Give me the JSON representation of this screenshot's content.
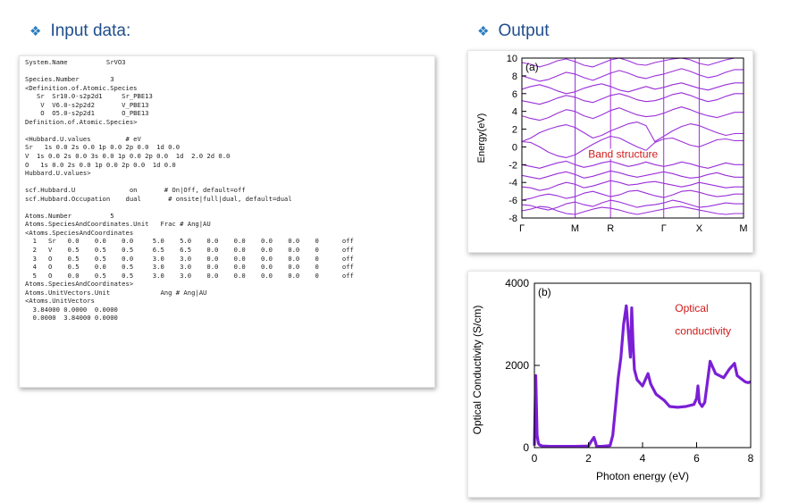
{
  "input_heading": {
    "bullet": "❖",
    "text": "Input data:"
  },
  "output_heading": {
    "bullet": "❖",
    "text": "Output"
  },
  "input_lines": [
    "System.Name          SrVO3",
    "",
    "Species.Number        3",
    "<Definition.of.Atomic.Species",
    "   Sr  Sr10.0-s2p2d1     Sr_PBE13",
    "    V  V6.0-s2p2d2       V_PBE13",
    "    O  O5.0-s2p2d1       O_PBE13",
    "Definition.of.Atomic.Species>",
    "",
    "<Hubbard.U.values         # eV",
    "Sr   1s 0.0 2s 0.0 1p 0.0 2p 0.0  1d 0.0",
    "V  1s 0.0 2s 0.0 3s 0.0 1p 0.0 2p 0.0  1d  2.0 2d 0.0",
    "O   1s 0.0 2s 0.0 1p 0.0 2p 0.0  1d 0.0",
    "Hubbard.U.values>",
    "",
    "scf.Hubbard.U              on       # On|Off, default=off",
    "scf.Hubbard.Occupation    dual       # onsite|full|dual, default=dual",
    "",
    "Atoms.Number          5",
    "Atoms.SpeciesAndCoordinates.Unit   Frac # Ang|AU",
    "<Atoms.SpeciesAndCoordinates",
    "  1   Sr   0.0    0.0    0.0     5.0    5.0    0.0    0.0    0.0    0.0    0      off",
    "  2   V    0.5    0.5    0.5     6.5    6.5    0.0    0.0    0.0    0.0    0      off",
    "  3   O    0.5    0.5    0.0     3.0    3.0    0.0    0.0    0.0    0.0    0      off",
    "  4   O    0.5    0.0    0.5     3.0    3.0    0.0    0.0    0.0    0.0    0      off",
    "  5   O    0.0    0.5    0.5     3.0    3.0    0.0    0.0    0.0    0.0    0      off",
    "Atoms.SpeciesAndCoordinates>",
    "Atoms.UnitVectors.Unit             Ang # Ang|AU",
    "<Atoms.UnitVectors",
    "  3.84000 0.0000  0.0000",
    "  0.0000  3.84000 0.0000"
  ],
  "band_plot": {
    "panel_label": "(a)",
    "annotation": "Band structure",
    "annotation_color": "#d11a1a",
    "ylabel": "Energy(eV)",
    "ylim": [
      -8,
      10
    ],
    "yticks": [
      "10",
      "8",
      "6",
      "4",
      "2",
      "0",
      "-2",
      "-4",
      "-6",
      "-8"
    ],
    "kpoints": [
      "Γ",
      "M",
      "R",
      "Γ",
      "X",
      "M"
    ],
    "line_color": "#9b30d9"
  },
  "cond_plot": {
    "panel_label": "(b)",
    "annotation_line1": "Optical",
    "annotation_line2": "conductivity",
    "annotation_color": "#d11a1a",
    "ylabel": "Optical Conductivity (S/cm)",
    "xlabel": "Photon energy (eV)",
    "ylim": [
      0,
      4000
    ],
    "xlim": [
      0,
      8
    ],
    "yticks": [
      "4000",
      "2000",
      "0"
    ],
    "xticks": [
      "0",
      "2",
      "4",
      "6",
      "8"
    ],
    "line_color": "#7b1fd6"
  },
  "chart_data": [
    {
      "type": "line",
      "title": "",
      "xlabel": "",
      "ylabel": "Energy(eV)",
      "ylim": [
        -8,
        10
      ],
      "x_tick_labels": [
        "Γ",
        "M",
        "R",
        "Γ",
        "X",
        "M"
      ],
      "x": [
        0.0,
        0.2,
        0.4,
        0.6,
        0.8,
        1.0,
        1.2,
        1.4,
        1.6,
        1.8,
        2.0,
        2.2,
        2.4,
        2.6,
        2.8,
        3.0,
        3.2,
        3.4,
        3.6,
        3.8,
        4.0,
        4.2,
        4.4,
        4.6,
        4.8,
        5.0
      ],
      "series": [
        {
          "values": [
            -7.2,
            -7.0,
            -6.7,
            -6.8,
            -7.2,
            -7.5,
            -7.6,
            -7.3,
            -7.0,
            -6.8,
            -6.9,
            -7.1,
            -7.4,
            -7.6,
            -7.4,
            -7.2,
            -7.0,
            -6.8,
            -6.7,
            -6.9,
            -7.1,
            -7.3,
            -7.5,
            -7.6,
            -7.5,
            -7.5
          ]
        },
        {
          "values": [
            -6.5,
            -6.6,
            -6.9,
            -7.1,
            -6.8,
            -6.4,
            -6.2,
            -6.5,
            -6.7,
            -6.3,
            -6.0,
            -6.2,
            -6.5,
            -6.8,
            -6.6,
            -6.5,
            -6.3,
            -6.0,
            -6.2,
            -6.5,
            -6.8,
            -6.7,
            -6.5,
            -6.3,
            -6.4,
            -6.4
          ]
        },
        {
          "values": [
            -6.0,
            -5.8,
            -5.5,
            -5.3,
            -5.5,
            -5.8,
            -5.6,
            -5.2,
            -5.0,
            -5.3,
            -5.6,
            -5.4,
            -5.0,
            -4.9,
            -5.2,
            -5.5,
            -5.7,
            -5.4,
            -5.0,
            -4.9,
            -5.1,
            -5.4,
            -5.6,
            -5.5,
            -5.3,
            -5.3
          ]
        },
        {
          "values": [
            -4.5,
            -4.6,
            -4.9,
            -4.7,
            -4.3,
            -4.0,
            -4.2,
            -4.6,
            -4.4,
            -4.1,
            -3.8,
            -4.0,
            -4.3,
            -4.2,
            -4.0,
            -3.9,
            -4.1,
            -4.3,
            -4.5,
            -4.3,
            -4.0,
            -4.2,
            -4.4,
            -4.6,
            -4.5,
            -4.5
          ]
        },
        {
          "values": [
            -3.2,
            -3.4,
            -3.6,
            -3.3,
            -3.0,
            -2.8,
            -3.1,
            -3.5,
            -3.3,
            -3.0,
            -2.7,
            -2.9,
            -3.2,
            -3.4,
            -3.2,
            -3.0,
            -2.8,
            -3.0,
            -3.3,
            -3.5,
            -3.4,
            -3.1,
            -2.9,
            -3.2,
            -3.4,
            -3.4
          ]
        },
        {
          "values": [
            -2.0,
            -2.2,
            -2.4,
            -2.1,
            -1.8,
            -1.6,
            -2.0,
            -2.3,
            -2.1,
            -1.8,
            -1.6,
            -1.9,
            -2.2,
            -2.0,
            -1.7,
            -2.0,
            -2.2,
            -2.0,
            -1.7,
            -1.9,
            -2.2,
            -2.4,
            -2.1,
            -1.8,
            -2.0,
            -2.0
          ]
        },
        {
          "values": [
            0.6,
            0.5,
            0.0,
            -0.6,
            -1.0,
            -1.2,
            -0.9,
            -0.3,
            0.3,
            0.8,
            1.2,
            1.0,
            0.5,
            0.0,
            -0.4,
            0.5,
            0.9,
            1.0,
            0.6,
            0.2,
            0.0,
            0.4,
            0.8,
            0.9,
            0.7,
            0.7
          ]
        },
        {
          "values": [
            0.6,
            1.0,
            1.6,
            2.0,
            2.3,
            2.5,
            2.2,
            1.6,
            1.0,
            1.3,
            1.8,
            2.2,
            2.6,
            2.8,
            2.4,
            0.6,
            1.2,
            1.8,
            2.3,
            2.6,
            2.4,
            2.0,
            1.6,
            1.3,
            1.5,
            1.5
          ]
        },
        {
          "values": [
            3.5,
            3.2,
            3.0,
            3.3,
            3.8,
            4.2,
            4.0,
            3.5,
            3.2,
            3.6,
            4.1,
            4.4,
            4.0,
            3.6,
            3.4,
            3.5,
            3.8,
            4.2,
            4.5,
            4.2,
            3.8,
            3.5,
            3.3,
            3.6,
            3.9,
            3.9
          ]
        },
        {
          "values": [
            5.2,
            5.0,
            4.8,
            5.1,
            5.5,
            5.8,
            5.6,
            5.2,
            5.0,
            5.4,
            5.8,
            6.0,
            5.7,
            5.3,
            5.1,
            5.2,
            5.5,
            5.9,
            6.1,
            5.8,
            5.4,
            5.1,
            5.3,
            5.7,
            6.0,
            6.0
          ]
        },
        {
          "values": [
            6.5,
            6.8,
            7.0,
            6.7,
            6.3,
            6.0,
            6.2,
            6.6,
            6.9,
            7.1,
            6.8,
            6.4,
            6.2,
            6.5,
            6.8,
            6.5,
            6.7,
            7.0,
            7.2,
            6.9,
            6.6,
            6.4,
            6.7,
            7.0,
            7.2,
            7.2
          ]
        },
        {
          "values": [
            8.0,
            7.7,
            7.4,
            7.6,
            8.0,
            8.4,
            8.2,
            7.8,
            7.5,
            7.9,
            8.3,
            8.6,
            8.3,
            7.9,
            7.7,
            8.0,
            8.2,
            8.5,
            8.8,
            8.5,
            8.1,
            7.8,
            8.0,
            8.4,
            8.7,
            8.7
          ]
        },
        {
          "values": [
            9.5,
            9.3,
            9.0,
            9.3,
            9.7,
            9.9,
            9.6,
            9.2,
            9.0,
            9.4,
            9.8,
            10.0,
            9.7,
            9.3,
            9.2,
            9.5,
            9.7,
            9.9,
            10.0,
            9.8,
            9.4,
            9.2,
            9.5,
            9.8,
            10.0,
            10.0
          ]
        }
      ]
    },
    {
      "type": "line",
      "title": "",
      "xlabel": "Photon energy (eV)",
      "ylabel": "Optical Conductivity (S/cm)",
      "xlim": [
        0,
        8
      ],
      "ylim": [
        0,
        4000
      ],
      "series": [
        {
          "x": [
            0.0,
            0.05,
            0.1,
            0.15,
            0.2,
            0.3,
            0.6,
            1.0,
            1.5,
            2.0,
            2.1,
            2.2,
            2.25,
            2.3,
            2.5,
            2.8,
            2.9,
            3.0,
            3.1,
            3.2,
            3.3,
            3.4,
            3.5,
            3.55,
            3.6,
            3.65,
            3.7,
            3.8,
            4.0,
            4.2,
            4.3,
            4.5,
            4.8,
            5.0,
            5.3,
            5.6,
            5.9,
            6.0,
            6.05,
            6.1,
            6.2,
            6.3,
            6.4,
            6.5,
            6.7,
            7.0,
            7.2,
            7.4,
            7.5,
            7.7,
            7.8,
            7.9,
            8.0
          ],
          "values": [
            50,
            1750,
            300,
            100,
            60,
            40,
            30,
            30,
            30,
            40,
            150,
            250,
            150,
            30,
            30,
            50,
            300,
            1000,
            1700,
            2200,
            3000,
            3450,
            2600,
            2200,
            3400,
            2500,
            1900,
            1650,
            1500,
            1800,
            1550,
            1300,
            1150,
            1000,
            980,
            1000,
            1050,
            1200,
            1500,
            1100,
            1000,
            1100,
            1600,
            2100,
            1800,
            1700,
            1900,
            2050,
            1750,
            1650,
            1600,
            1580,
            1600
          ]
        }
      ]
    }
  ]
}
